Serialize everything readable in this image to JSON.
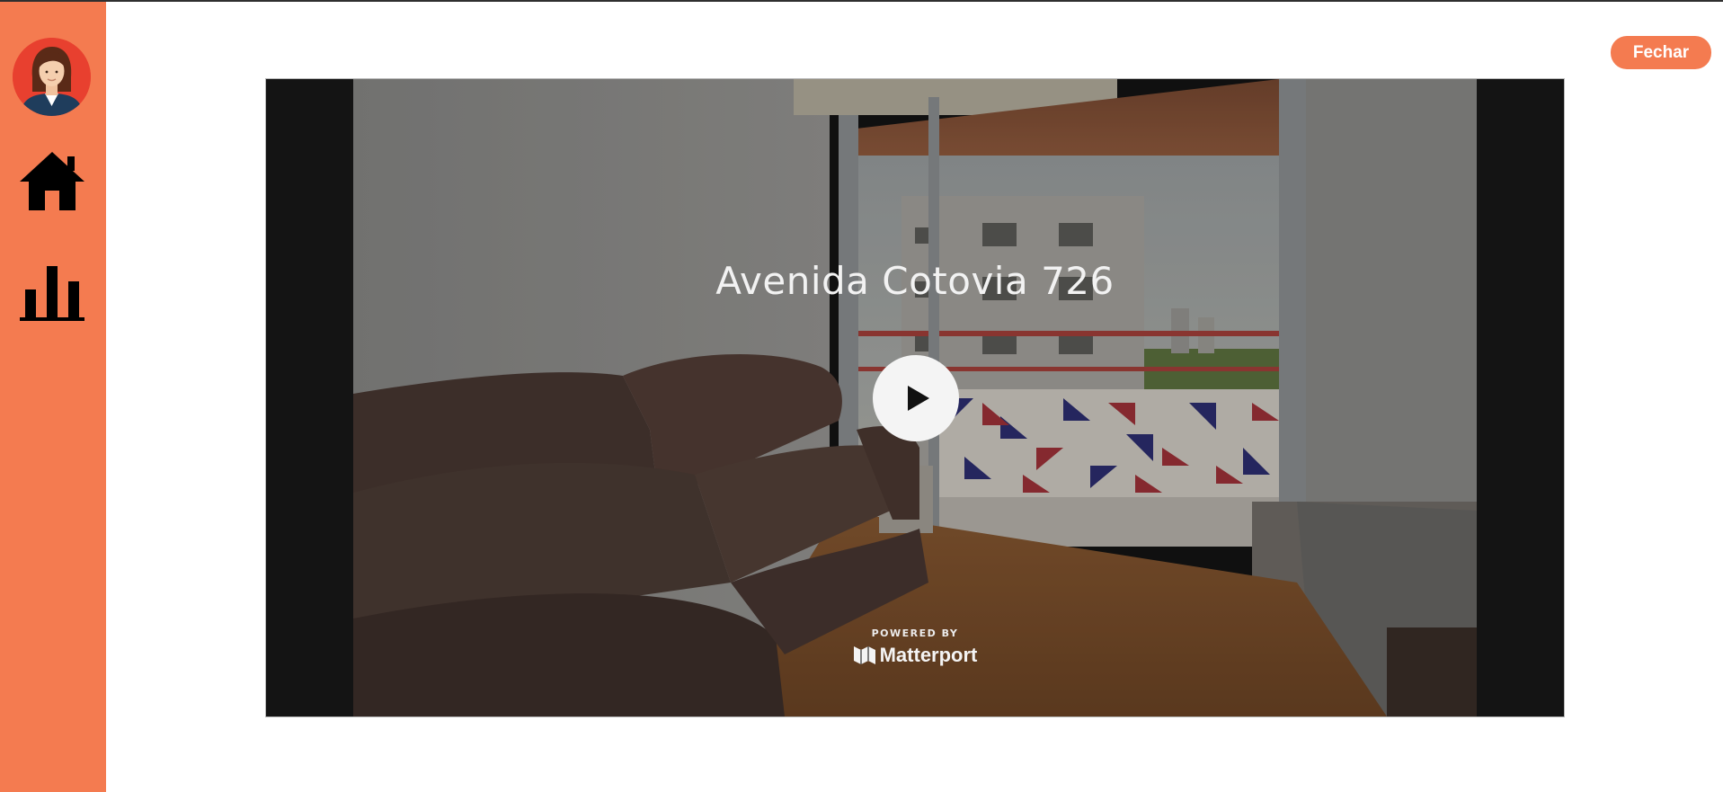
{
  "sidebar": {
    "avatar": "avatar-woman",
    "items": [
      {
        "icon": "home-icon"
      },
      {
        "icon": "bar-chart-icon"
      }
    ]
  },
  "header": {
    "close_label": "Fechar"
  },
  "viewer": {
    "title": "Avenida Cotovia 726",
    "powered_by": "POWERED BY",
    "brand": "Matterport"
  },
  "colors": {
    "accent": "#f47b50",
    "avatar_bg": "#e8402f",
    "letterbox": "#141414"
  }
}
